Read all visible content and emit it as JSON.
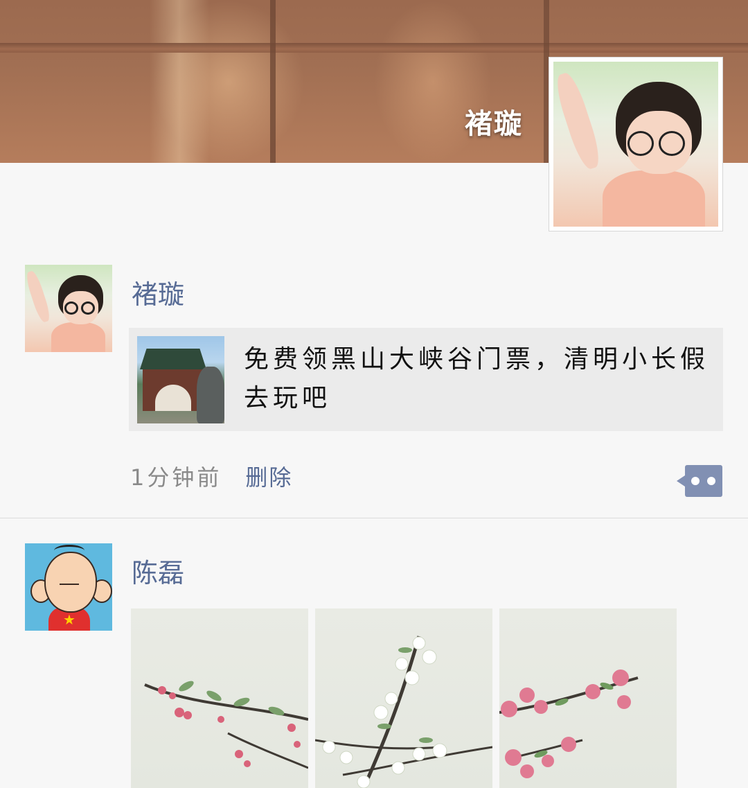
{
  "cover": {
    "owner_name": "褚璇"
  },
  "posts": [
    {
      "nickname": "褚璇",
      "share": {
        "text": "免费领黑山大峡谷门票，清明小长假去玩吧"
      },
      "time": "1分钟前",
      "delete_label": "删除"
    },
    {
      "nickname": "陈磊",
      "photos": [
        {
          "alt": "plum-blossom-painting"
        },
        {
          "alt": "pear-blossom-painting"
        },
        {
          "alt": "peach-blossom-painting"
        }
      ]
    }
  ],
  "colors": {
    "link": "#576b95",
    "meta": "#8a8a8a",
    "comment_button": "#8190b3",
    "card_bg": "#ebebeb",
    "page_bg": "#f7f7f7"
  },
  "icons": {
    "comment": "comment-dots-icon"
  }
}
